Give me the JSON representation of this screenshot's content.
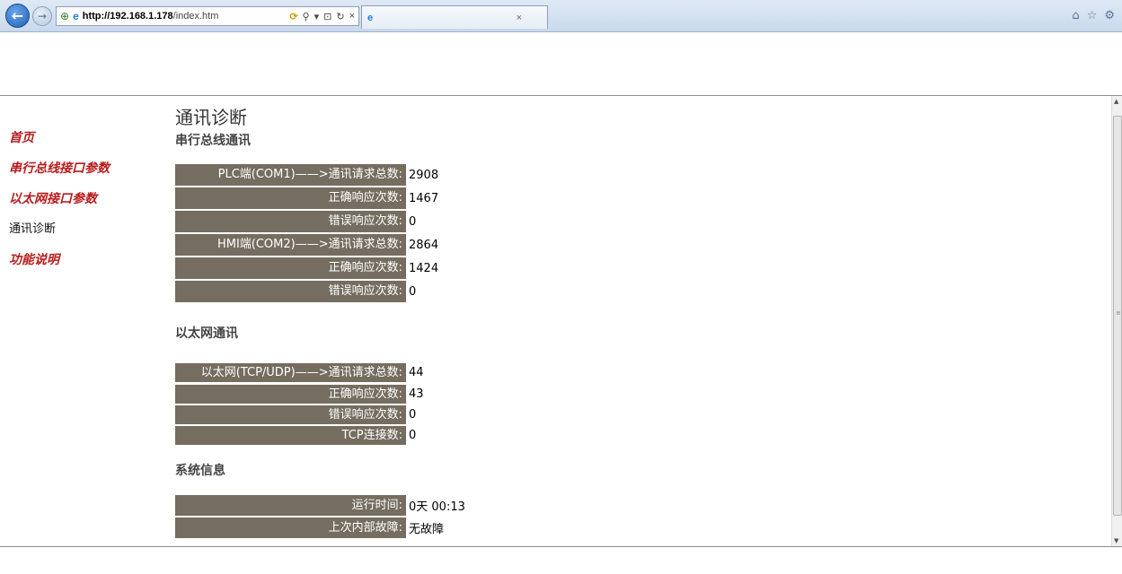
{
  "browser": {
    "url_host": "http://192.168.1.178",
    "url_path": "/index.htm",
    "tab_close": "×",
    "back_glyph": "←",
    "forward_glyph": "→",
    "address_tools": [
      "⚲",
      "▾",
      "⊡",
      "↻",
      "×"
    ],
    "right_icons": [
      "⌂",
      "☆",
      "⚙"
    ]
  },
  "sidebar": {
    "items": [
      {
        "label": "首页"
      },
      {
        "label": "串行总线接口参数"
      },
      {
        "label": "以太网接口参数"
      },
      {
        "label": "通讯诊断"
      },
      {
        "label": "功能说明"
      }
    ]
  },
  "main": {
    "title": "通讯诊断",
    "serial": {
      "heading": "串行总线通讯",
      "rows": [
        {
          "label": "PLC端(COM1)——>通讯请求总数:",
          "value": "2908"
        },
        {
          "label": "正确响应次数:",
          "value": "1467"
        },
        {
          "label": "错误响应次数:",
          "value": "0"
        },
        {
          "label": "HMI端(COM2)——>通讯请求总数:",
          "value": "2864"
        },
        {
          "label": "正确响应次数:",
          "value": "1424"
        },
        {
          "label": "错误响应次数:",
          "value": "0"
        }
      ]
    },
    "ethernet": {
      "heading": "以太网通讯",
      "rows": [
        {
          "label": "以太网(TCP/UDP)——>通讯请求总数:",
          "value": "44"
        },
        {
          "label": "正确响应次数:",
          "value": "43"
        },
        {
          "label": "错误响应次数:",
          "value": "0"
        },
        {
          "label": "TCP连接数:",
          "value": "0"
        }
      ]
    },
    "system": {
      "heading": "系统信息",
      "rows": [
        {
          "label": "运行时间:",
          "value": "0天 00:13"
        },
        {
          "label": "上次内部故障:",
          "value": "无故障"
        }
      ]
    }
  },
  "colors": {
    "label_bg": "#756d60",
    "nav_link": "#b71c1c"
  }
}
